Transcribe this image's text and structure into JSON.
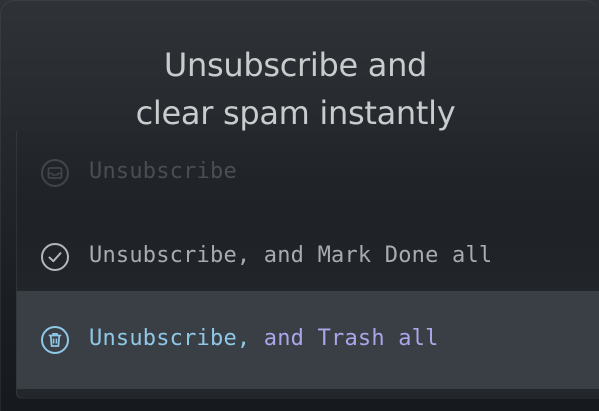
{
  "headline": {
    "line1": "Unsubscribe and",
    "line2": "clear spam instantly"
  },
  "menu": {
    "items": [
      {
        "label": "Unsubscribe",
        "icon": "unsubscribe-mail-icon",
        "state": "faded"
      },
      {
        "label": "Unsubscribe, and Mark Done all",
        "icon": "check-circle-icon",
        "state": "normal"
      },
      {
        "label": "Unsubscribe, and Trash all",
        "label_part1": "Unsubscribe,",
        "label_part2": " and Trash all",
        "icon": "trash-circle-icon",
        "state": "selected"
      }
    ]
  },
  "colors": {
    "selected_text": "#8fc7e6",
    "selected_text_secondary": "#a9a6ea",
    "selected_background": "#3a3f45",
    "normal_text": "#a9abae",
    "faded_text": "#4a4e52"
  }
}
